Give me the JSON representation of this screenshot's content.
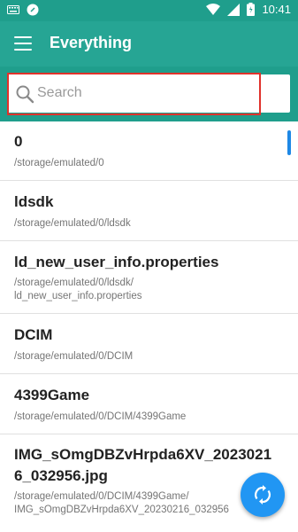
{
  "status_bar": {
    "time": "10:41",
    "icons": [
      "keyboard-icon",
      "disc-icon",
      "wifi-icon",
      "signal-icon",
      "battery-icon"
    ]
  },
  "toolbar": {
    "title": "Everything"
  },
  "search": {
    "placeholder": "Search",
    "value": ""
  },
  "list": {
    "items": [
      {
        "name": "0",
        "path": "/storage/emulated/0"
      },
      {
        "name": "ldsdk",
        "path": "/storage/emulated/0/ldsdk"
      },
      {
        "name": "ld_new_user_info.properties",
        "path": "/storage/emulated/0/ldsdk/\nld_new_user_info.properties"
      },
      {
        "name": "DCIM",
        "path": "/storage/emulated/0/DCIM"
      },
      {
        "name": "4399Game",
        "path": "/storage/emulated/0/DCIM/4399Game"
      },
      {
        "name": "IMG_sOmgDBZvHrpda6XV_2023021\n6_032956.jpg",
        "path": "/storage/emulated/0/DCIM/4399Game/\nIMG_sOmgDBZvHrpda6XV_20230216_032956"
      }
    ]
  },
  "fab": {
    "icon": "sync-icon"
  },
  "colors": {
    "status_bar": "#1f9e8c",
    "toolbar": "#26a594",
    "fab": "#2196f3",
    "annotation": "#e0322b"
  }
}
